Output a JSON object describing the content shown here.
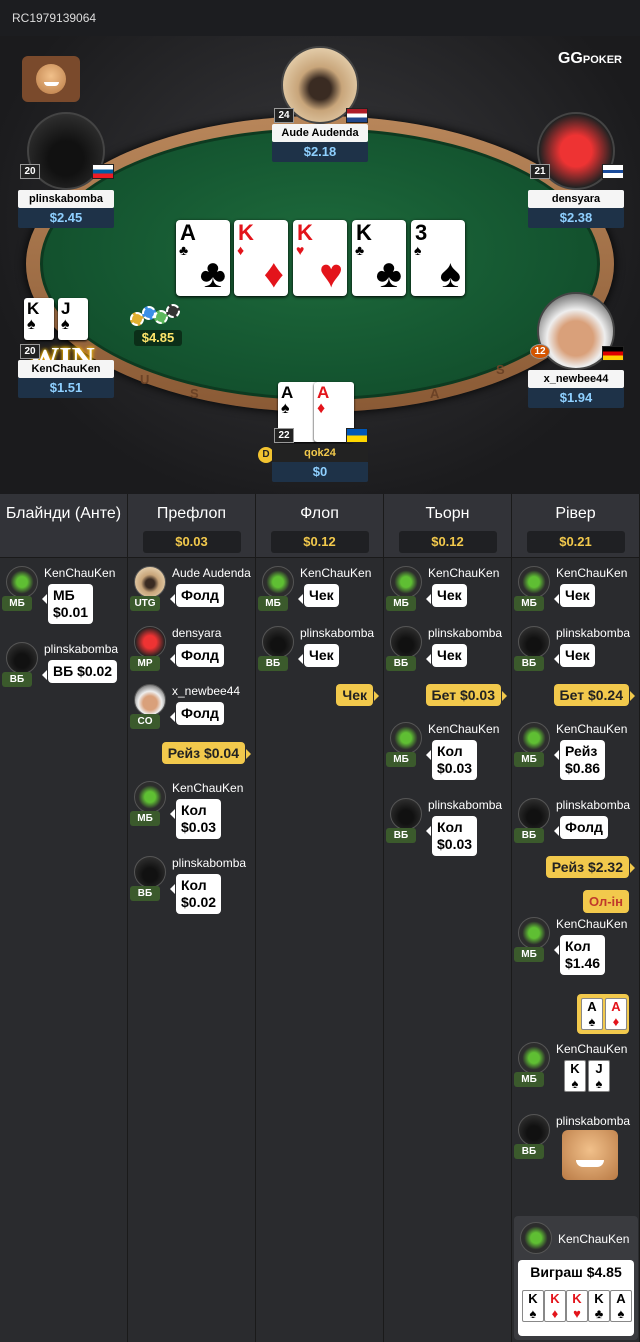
{
  "hand_id": "RC1979139064",
  "brand": {
    "main": "GG",
    "sub": "POKER"
  },
  "seats": {
    "top": {
      "name": "Aude Audenda",
      "stack": "$2.18",
      "level": "24"
    },
    "top_left": {
      "name": "plinskabomba",
      "stack": "$2.45",
      "level": "20"
    },
    "top_right": {
      "name": "densyara",
      "stack": "$2.38",
      "level": "21"
    },
    "left": {
      "name": "KenChauKen",
      "stack": "$1.51",
      "level": "20",
      "badge": "WIN",
      "cards": [
        "K",
        "J"
      ]
    },
    "right": {
      "name": "x_newbee44",
      "stack": "$1.94",
      "level": "12"
    },
    "bottom": {
      "name": "qok24",
      "stack": "$0",
      "level": "22",
      "cards": [
        "A",
        "A"
      ],
      "dealer": "D"
    }
  },
  "board": [
    {
      "rank": "A",
      "suit": "♣",
      "color": "#000000"
    },
    {
      "rank": "K",
      "suit": "♦",
      "color": "#e3141b"
    },
    {
      "rank": "K",
      "suit": "♥",
      "color": "#e3141b"
    },
    {
      "rank": "K",
      "suit": "♣",
      "color": "#000000"
    },
    {
      "rank": "3",
      "suit": "♠",
      "color": "#000000"
    }
  ],
  "pot": "$4.85",
  "rim_text": [
    "U",
    "S",
    "A",
    "S"
  ],
  "columns": [
    {
      "title": "Блайнди (Анте)",
      "pot": ""
    },
    {
      "title": "Префлоп",
      "pot": "$0.03"
    },
    {
      "title": "Флоп",
      "pot": "$0.12"
    },
    {
      "title": "Тьорн",
      "pot": "$0.12"
    },
    {
      "title": "Рівер",
      "pot": "$0.21"
    }
  ],
  "blinds": [
    {
      "name": "KenChauKen",
      "pos": "МБ",
      "action": "МБ",
      "amount": "$0.01"
    },
    {
      "name": "plinskabomba",
      "pos": "ВБ",
      "action": "ВБ $0.02"
    }
  ],
  "preflop": [
    {
      "name": "Aude Audenda",
      "pos": "UTG",
      "action": "Фолд"
    },
    {
      "name": "densyara",
      "pos": "MP",
      "action": "Фолд"
    },
    {
      "name": "x_newbee44",
      "pos": "CO",
      "action": "Фолд"
    },
    {
      "yellow": "Рейз $0.04"
    },
    {
      "name": "KenChauKen",
      "pos": "МБ",
      "action": "Кол",
      "amount": "$0.03"
    },
    {
      "name": "plinskabomba",
      "pos": "ВБ",
      "action": "Кол",
      "amount": "$0.02"
    }
  ],
  "flop": [
    {
      "name": "KenChauKen",
      "pos": "МБ",
      "action": "Чек"
    },
    {
      "name": "plinskabomba",
      "pos": "ВБ",
      "action": "Чек"
    },
    {
      "yellow": "Чек"
    }
  ],
  "turn": [
    {
      "name": "KenChauKen",
      "pos": "МБ",
      "action": "Чек"
    },
    {
      "name": "plinskabomba",
      "pos": "ВБ",
      "action": "Чек"
    },
    {
      "yellow": "Бет $0.03"
    },
    {
      "name": "KenChauKen",
      "pos": "МБ",
      "action": "Кол",
      "amount": "$0.03"
    },
    {
      "name": "plinskabomba",
      "pos": "ВБ",
      "action": "Кол",
      "amount": "$0.03"
    }
  ],
  "river": [
    {
      "name": "KenChauKen",
      "pos": "МБ",
      "action": "Чек"
    },
    {
      "name": "plinskabomba",
      "pos": "ВБ",
      "action": "Чек"
    },
    {
      "yellow": "Бет $0.24"
    },
    {
      "name": "KenChauKen",
      "pos": "МБ",
      "action": "Рейз",
      "amount": "$0.86"
    },
    {
      "name": "plinskabomba",
      "pos": "ВБ",
      "action": "Фолд"
    },
    {
      "yellow": "Рейз $2.32",
      "allin": "Ол-ін"
    },
    {
      "name": "KenChauKen",
      "pos": "МБ",
      "action": "Кол",
      "amount": "$1.46"
    },
    {
      "shown_cards": [
        "A",
        "A"
      ]
    },
    {
      "name": "KenChauKen",
      "pos": "МБ",
      "shown_cards": [
        "K",
        "J"
      ]
    },
    {
      "name": "plinskabomba",
      "pos": "ВБ",
      "emote": "emoji-face"
    }
  ],
  "winner": {
    "name": "KenChauKen",
    "label": "Виграш $4.85",
    "cards": [
      "K",
      "K",
      "K",
      "K",
      "A"
    ]
  }
}
